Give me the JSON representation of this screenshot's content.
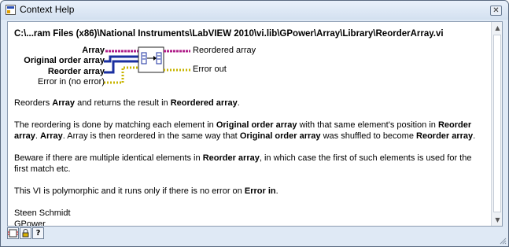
{
  "window": {
    "title": "Context Help"
  },
  "help": {
    "path": "C:\\...ram Files (x86)\\National Instruments\\LabVIEW 2010\\vi.lib\\GPower\\Array\\Library\\ReorderArray.vi",
    "inputs": [
      {
        "label": "Array",
        "bold": true
      },
      {
        "label": "Original order array",
        "bold": true
      },
      {
        "label": "Reorder array",
        "bold": true
      },
      {
        "label": "Error in (no error)",
        "bold": false
      }
    ],
    "outputs": [
      {
        "label": "Reordered array"
      },
      {
        "label": "Error out"
      }
    ],
    "p1": {
      "t1": "Reorders ",
      "b1": "Array",
      "t2": " and returns the result in ",
      "b2": "Reordered array",
      "t3": "."
    },
    "p2": {
      "t1": "The reordering is done by matching each element in ",
      "b1": "Original order array",
      "t2": " with that same element's position in ",
      "b2": "Reorder array",
      "t3": ". ",
      "b3": "Array",
      "t4": ". Array is then reordered in the same way that ",
      "b4": "Original order array",
      "t5": " was shuffled to become ",
      "b5": "Reorder array",
      "t6": "."
    },
    "p3": {
      "t1": "Beware if there are multiple identical elements in ",
      "b1": "Reorder array",
      "t2": ", in which case the first of such elements is used for the first match etc."
    },
    "p4": {
      "t1": "This VI is polymorphic and it runs only if there is no error on ",
      "b1": "Error in",
      "t2": "."
    },
    "author": {
      "name": "Steen Schmidt",
      "company": "GPower"
    }
  },
  "colors": {
    "array_wire": "#b0208a",
    "error_wire": "#c8b400",
    "int_wire": "#1a2fa0"
  }
}
